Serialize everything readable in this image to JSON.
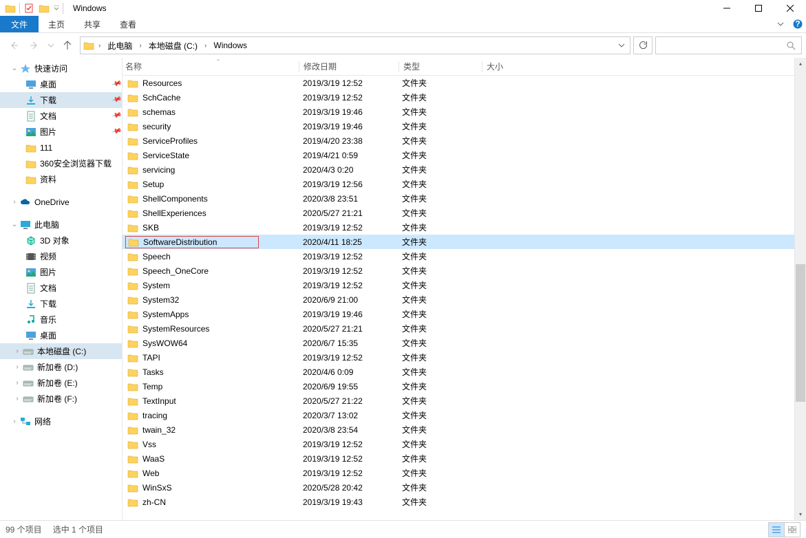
{
  "window": {
    "title": "Windows"
  },
  "ribbon": {
    "file": "文件",
    "home": "主页",
    "share": "共享",
    "view": "查看"
  },
  "breadcrumb": {
    "items": [
      "此电脑",
      "本地磁盘 (C:)",
      "Windows"
    ]
  },
  "sidebar": {
    "quickaccess": {
      "label": "快速访问",
      "items": [
        {
          "label": "桌面",
          "icon": "desktop",
          "pinned": true
        },
        {
          "label": "下载",
          "icon": "download",
          "pinned": true,
          "selected": true
        },
        {
          "label": "文档",
          "icon": "doc",
          "pinned": true
        },
        {
          "label": "图片",
          "icon": "pic",
          "pinned": true
        },
        {
          "label": "111",
          "icon": "folder"
        },
        {
          "label": "360安全浏览器下载",
          "icon": "folder"
        },
        {
          "label": "资料",
          "icon": "folder"
        }
      ]
    },
    "onedrive": {
      "label": "OneDrive"
    },
    "thispc": {
      "label": "此电脑",
      "items": [
        {
          "label": "3D 对象",
          "icon": "3d"
        },
        {
          "label": "视频",
          "icon": "video"
        },
        {
          "label": "图片",
          "icon": "pic"
        },
        {
          "label": "文档",
          "icon": "doc"
        },
        {
          "label": "下载",
          "icon": "download"
        },
        {
          "label": "音乐",
          "icon": "music"
        },
        {
          "label": "桌面",
          "icon": "desktop"
        },
        {
          "label": "本地磁盘 (C:)",
          "icon": "drive",
          "expand": true,
          "selected": true
        },
        {
          "label": "新加卷 (D:)",
          "icon": "drive",
          "expand": true
        },
        {
          "label": "新加卷 (E:)",
          "icon": "drive",
          "expand": true
        },
        {
          "label": "新加卷 (F:)",
          "icon": "drive",
          "expand": true
        }
      ]
    },
    "network": {
      "label": "网络"
    }
  },
  "columns": {
    "name": "名称",
    "date": "修改日期",
    "type": "类型",
    "size": "大小"
  },
  "files": [
    {
      "name": "Resources",
      "date": "2019/3/19 12:52",
      "type": "文件夹"
    },
    {
      "name": "SchCache",
      "date": "2019/3/19 12:52",
      "type": "文件夹"
    },
    {
      "name": "schemas",
      "date": "2019/3/19 19:46",
      "type": "文件夹"
    },
    {
      "name": "security",
      "date": "2019/3/19 19:46",
      "type": "文件夹"
    },
    {
      "name": "ServiceProfiles",
      "date": "2019/4/20 23:38",
      "type": "文件夹"
    },
    {
      "name": "ServiceState",
      "date": "2019/4/21 0:59",
      "type": "文件夹"
    },
    {
      "name": "servicing",
      "date": "2020/4/3 0:20",
      "type": "文件夹"
    },
    {
      "name": "Setup",
      "date": "2019/3/19 12:56",
      "type": "文件夹"
    },
    {
      "name": "ShellComponents",
      "date": "2020/3/8 23:51",
      "type": "文件夹"
    },
    {
      "name": "ShellExperiences",
      "date": "2020/5/27 21:21",
      "type": "文件夹"
    },
    {
      "name": "SKB",
      "date": "2019/3/19 12:52",
      "type": "文件夹"
    },
    {
      "name": "SoftwareDistribution",
      "date": "2020/4/11 18:25",
      "type": "文件夹",
      "selected": true,
      "boxed": true
    },
    {
      "name": "Speech",
      "date": "2019/3/19 12:52",
      "type": "文件夹"
    },
    {
      "name": "Speech_OneCore",
      "date": "2019/3/19 12:52",
      "type": "文件夹"
    },
    {
      "name": "System",
      "date": "2019/3/19 12:52",
      "type": "文件夹"
    },
    {
      "name": "System32",
      "date": "2020/6/9 21:00",
      "type": "文件夹"
    },
    {
      "name": "SystemApps",
      "date": "2019/3/19 19:46",
      "type": "文件夹"
    },
    {
      "name": "SystemResources",
      "date": "2020/5/27 21:21",
      "type": "文件夹"
    },
    {
      "name": "SysWOW64",
      "date": "2020/6/7 15:35",
      "type": "文件夹"
    },
    {
      "name": "TAPI",
      "date": "2019/3/19 12:52",
      "type": "文件夹"
    },
    {
      "name": "Tasks",
      "date": "2020/4/6 0:09",
      "type": "文件夹"
    },
    {
      "name": "Temp",
      "date": "2020/6/9 19:55",
      "type": "文件夹"
    },
    {
      "name": "TextInput",
      "date": "2020/5/27 21:22",
      "type": "文件夹"
    },
    {
      "name": "tracing",
      "date": "2020/3/7 13:02",
      "type": "文件夹"
    },
    {
      "name": "twain_32",
      "date": "2020/3/8 23:54",
      "type": "文件夹"
    },
    {
      "name": "Vss",
      "date": "2019/3/19 12:52",
      "type": "文件夹"
    },
    {
      "name": "WaaS",
      "date": "2019/3/19 12:52",
      "type": "文件夹"
    },
    {
      "name": "Web",
      "date": "2019/3/19 12:52",
      "type": "文件夹"
    },
    {
      "name": "WinSxS",
      "date": "2020/5/28 20:42",
      "type": "文件夹"
    },
    {
      "name": "zh-CN",
      "date": "2019/3/19 19:43",
      "type": "文件夹"
    }
  ],
  "status": {
    "count": "99 个项目",
    "selected": "选中 1 个项目"
  }
}
